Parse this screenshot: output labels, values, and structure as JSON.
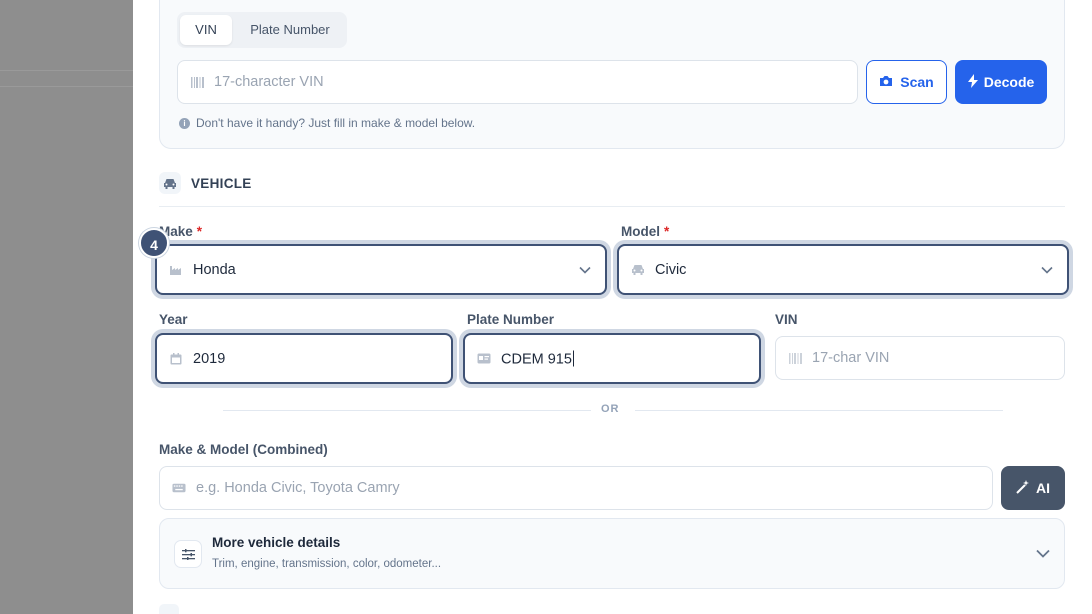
{
  "vin_section": {
    "tabs": [
      {
        "label": "VIN",
        "active": true
      },
      {
        "label": "Plate Number",
        "active": false
      }
    ],
    "vin_input": {
      "placeholder": "17-character VIN",
      "value": ""
    },
    "scan_label": "Scan",
    "decode_label": "Decode",
    "hint": "Don't have it handy? Just fill in make & model below."
  },
  "vehicle_section": {
    "title": "VEHICLE",
    "step_badge": "4",
    "make": {
      "label": "Make",
      "required": "*",
      "value": "Honda"
    },
    "model": {
      "label": "Model",
      "required": "*",
      "value": "Civic"
    },
    "year": {
      "label": "Year",
      "value": "2019"
    },
    "plate": {
      "label": "Plate Number",
      "value": "CDEM 915"
    },
    "vin": {
      "label": "VIN",
      "placeholder": "17-char VIN",
      "value": ""
    },
    "or_text": "OR",
    "combined": {
      "label": "Make & Model (Combined)",
      "placeholder": "e.g. Honda Civic, Toyota Camry",
      "value": ""
    },
    "ai_label": "AI",
    "more": {
      "title": "More vehicle details",
      "subtitle": "Trim, engine, transmission, color, odometer..."
    }
  },
  "colors": {
    "primary": "#2563eb",
    "focus_border": "#3f5275",
    "required": "#dc2626",
    "ai_button": "#475569"
  },
  "icons": [
    "barcode-icon",
    "camera-icon",
    "bolt-icon",
    "info-icon",
    "car-icon",
    "factory-icon",
    "chevron-down-icon",
    "calendar-icon",
    "id-card-icon",
    "keyboard-icon",
    "magic-wand-icon",
    "sliders-icon"
  ]
}
